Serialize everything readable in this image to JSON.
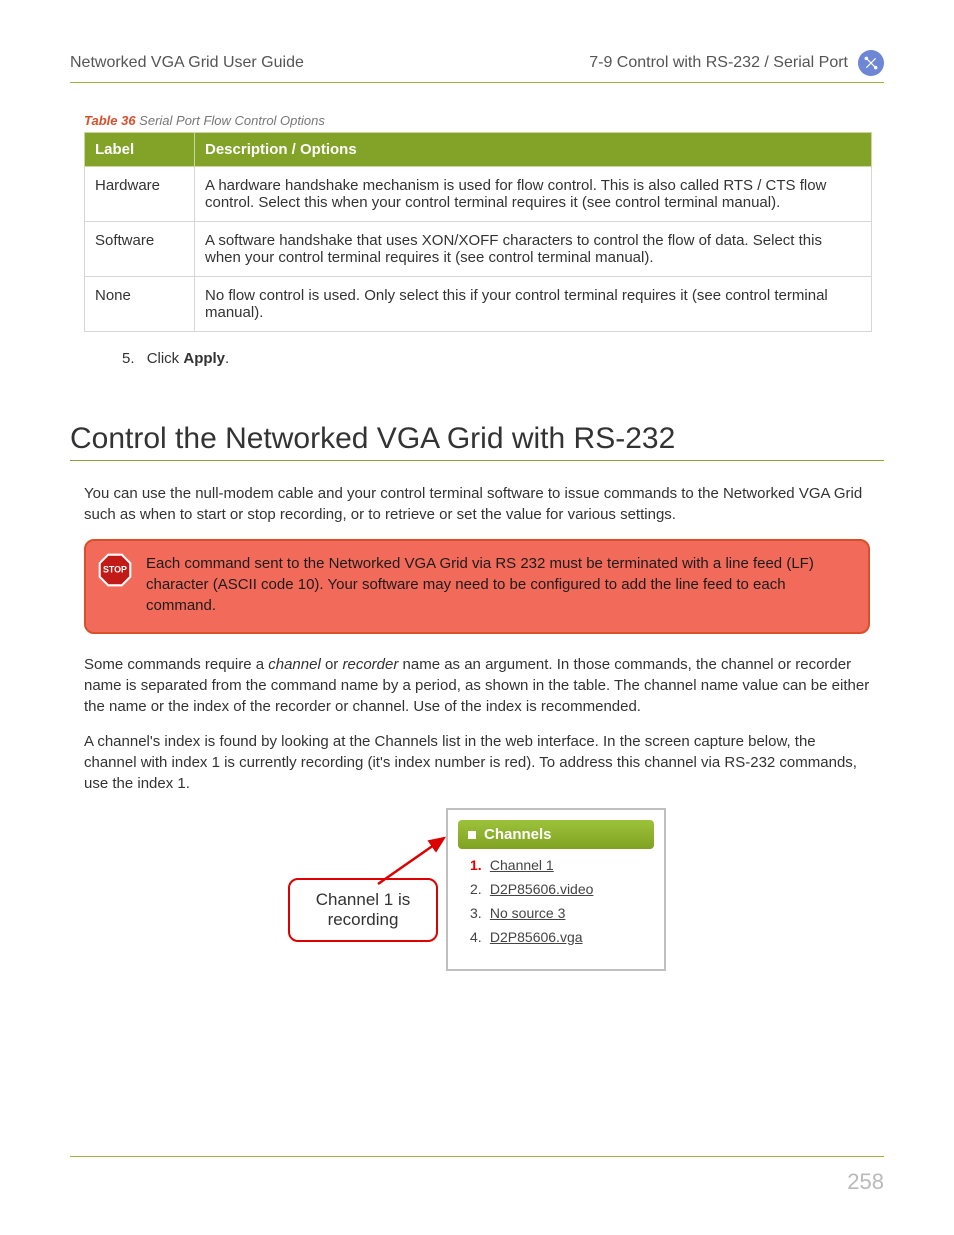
{
  "header": {
    "left": "Networked VGA Grid User Guide",
    "right": "7-9 Control with RS-232 / Serial Port"
  },
  "table": {
    "caption_prefix": "Table 36",
    "caption_text": "Serial Port Flow Control Options",
    "headers": {
      "col1": "Label",
      "col2": "Description / Options"
    },
    "rows": [
      {
        "label": "Hardware",
        "desc": "A hardware handshake mechanism is used for flow control. This is also called RTS / CTS flow control. Select this when your control terminal requires it (see control terminal manual)."
      },
      {
        "label": "Software",
        "desc": "A software handshake that uses XON/XOFF characters to control the flow of data. Select this when your control terminal requires it (see control terminal manual)."
      },
      {
        "label": "None",
        "desc": "No flow control is used. Only select this if your control terminal requires it (see control terminal manual)."
      }
    ]
  },
  "step": {
    "num": "5.",
    "prefix": "Click ",
    "bold": "Apply",
    "suffix": "."
  },
  "heading": "Control the Networked VGA Grid with RS-232",
  "para1": "You can use the null-modem cable and your control terminal software to issue commands to the Networked VGA Grid such as when to start or stop recording, or to retrieve or set the value for various settings.",
  "stop_label": "STOP",
  "stop_text": "Each command sent to the Networked VGA Grid via RS 232 must be terminated with a line feed (LF) character (ASCII code 10). Your software may need to be configured to add the line feed to each command.",
  "para2a": "Some commands require a ",
  "para2_em1": "channel",
  "para2b": " or ",
  "para2_em2": "recorder",
  "para2c": " name as an argument. In those commands, the channel or recorder name is separated from the command name by a period, as shown in the table. The channel name value can be either the name or the index of the recorder or channel. Use of the index is recommended.",
  "para3": "A channel's index is found by looking at the Channels list in the web interface. In the screen capture below, the channel with index 1 is currently recording (it's index number is red). To address this channel via RS-232 commands, use the index 1.",
  "callout": "Channel 1 is recording",
  "channels": {
    "title": "Channels",
    "items": [
      {
        "num": "1.",
        "name": "Channel 1",
        "recording": true
      },
      {
        "num": "2.",
        "name": "D2P85606.video",
        "recording": false
      },
      {
        "num": "3.",
        "name": "No source 3",
        "recording": false
      },
      {
        "num": "4.",
        "name": "D2P85606.vga",
        "recording": false
      }
    ]
  },
  "page_number": "258"
}
